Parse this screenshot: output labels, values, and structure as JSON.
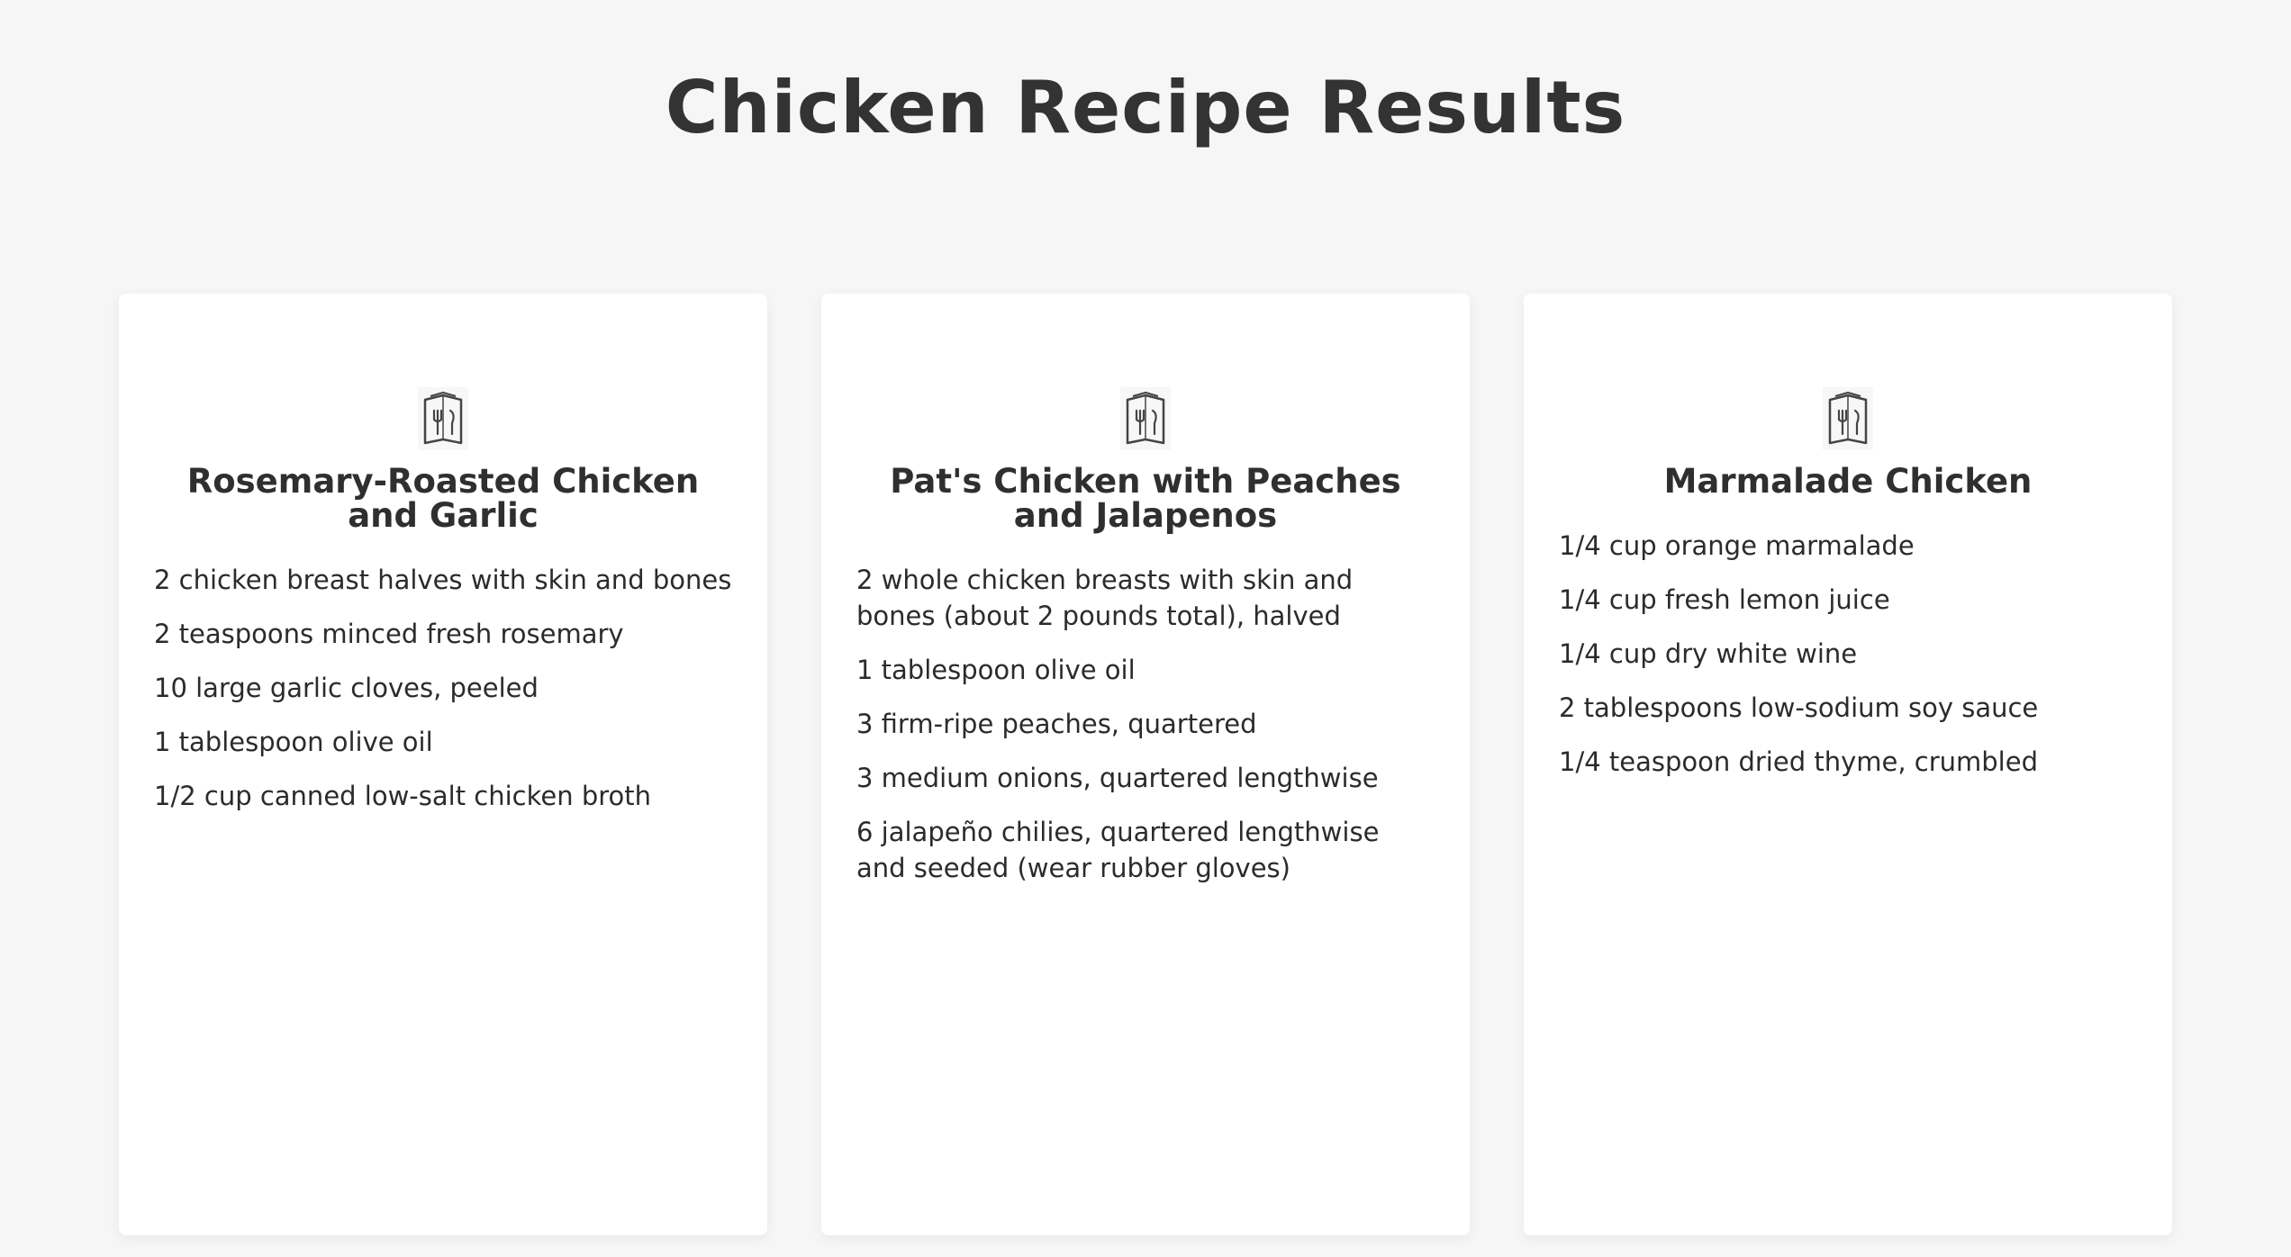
{
  "page": {
    "title": "Chicken Recipe Results"
  },
  "recipes": [
    {
      "title": "Rosemary-Roasted Chicken and Garlic",
      "icon": "menu-utensils-icon",
      "ingredients": [
        "2 chicken breast halves with skin and bones",
        "2 teaspoons minced fresh rosemary",
        "10 large garlic cloves, peeled",
        "1 tablespoon olive oil",
        "1/2 cup canned low-salt chicken broth"
      ]
    },
    {
      "title": "Pat's Chicken with Peaches and Jalapenos",
      "icon": "menu-utensils-icon",
      "ingredients": [
        "2 whole chicken breasts with skin and bones (about 2 pounds total), halved",
        "1 tablespoon olive oil",
        "3 firm-ripe peaches, quartered",
        "3 medium onions, quartered lengthwise",
        "6 jalapeño chilies, quartered lengthwise and seeded (wear rubber gloves)"
      ]
    },
    {
      "title": "Marmalade Chicken",
      "icon": "menu-utensils-icon",
      "ingredients": [
        "1/4 cup orange marmalade",
        "1/4 cup fresh lemon juice",
        "1/4 cup dry white wine",
        "2 tablespoons low-sodium soy sauce",
        "1/4 teaspoon dried thyme, crumbled"
      ]
    }
  ],
  "colors": {
    "background": "#f6f6f6",
    "card": "#ffffff",
    "text": "#333333"
  }
}
